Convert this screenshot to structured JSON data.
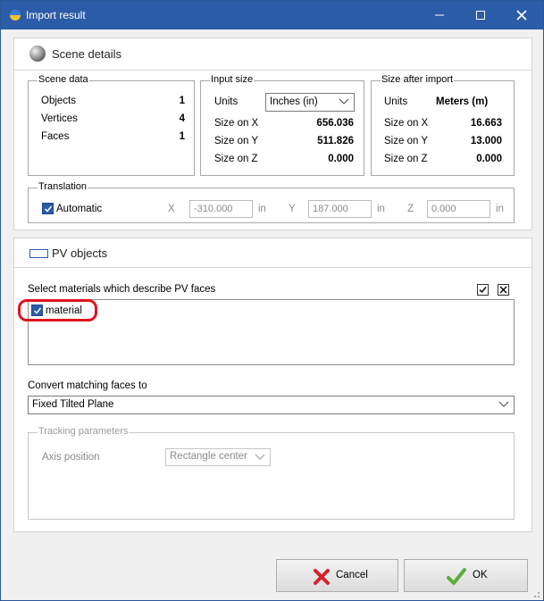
{
  "window": {
    "title": "Import result"
  },
  "scene": {
    "header": "Scene details",
    "scene_data": {
      "label": "Scene data",
      "rows": [
        {
          "name": "Objects",
          "value": "1"
        },
        {
          "name": "Vertices",
          "value": "4"
        },
        {
          "name": "Faces",
          "value": "1"
        }
      ]
    },
    "input_size": {
      "label": "Input size",
      "units_label": "Units",
      "units_value": "Inches (in)",
      "rows": [
        {
          "name": "Size on X",
          "value": "656.036"
        },
        {
          "name": "Size on Y",
          "value": "511.826"
        },
        {
          "name": "Size on Z",
          "value": "0.000"
        }
      ]
    },
    "after_import": {
      "label": "Size after import",
      "units_label": "Units",
      "units_value": "Meters (m)",
      "rows": [
        {
          "name": "Size on X",
          "value": "16.663"
        },
        {
          "name": "Size on Y",
          "value": "13.000"
        },
        {
          "name": "Size on Z",
          "value": "0.000"
        }
      ]
    },
    "translation": {
      "label": "Translation",
      "automatic_label": "Automatic",
      "x_label": "X",
      "x_value": "-310.000",
      "x_unit": "in",
      "y_label": "Y",
      "y_value": "187.000",
      "y_unit": "in",
      "z_label": "Z",
      "z_value": "0.000",
      "z_unit": "in"
    }
  },
  "pv": {
    "header": "PV objects",
    "materials_label": "Select materials which describe PV faces",
    "materials": [
      {
        "name": "material",
        "checked": true
      }
    ],
    "convert_label": "Convert matching faces to",
    "convert_value": "Fixed Tilted Plane",
    "tracking": {
      "label": "Tracking parameters",
      "axis_label": "Axis position",
      "axis_value": "Rectangle center"
    }
  },
  "buttons": {
    "cancel": "Cancel",
    "ok": "OK"
  },
  "colors": {
    "titlebar": "#2b5ca8",
    "highlight": "#e0141e",
    "check": "#2b5ca8",
    "ok_icon": "#5aae3a",
    "cancel_icon": "#d8202a"
  }
}
